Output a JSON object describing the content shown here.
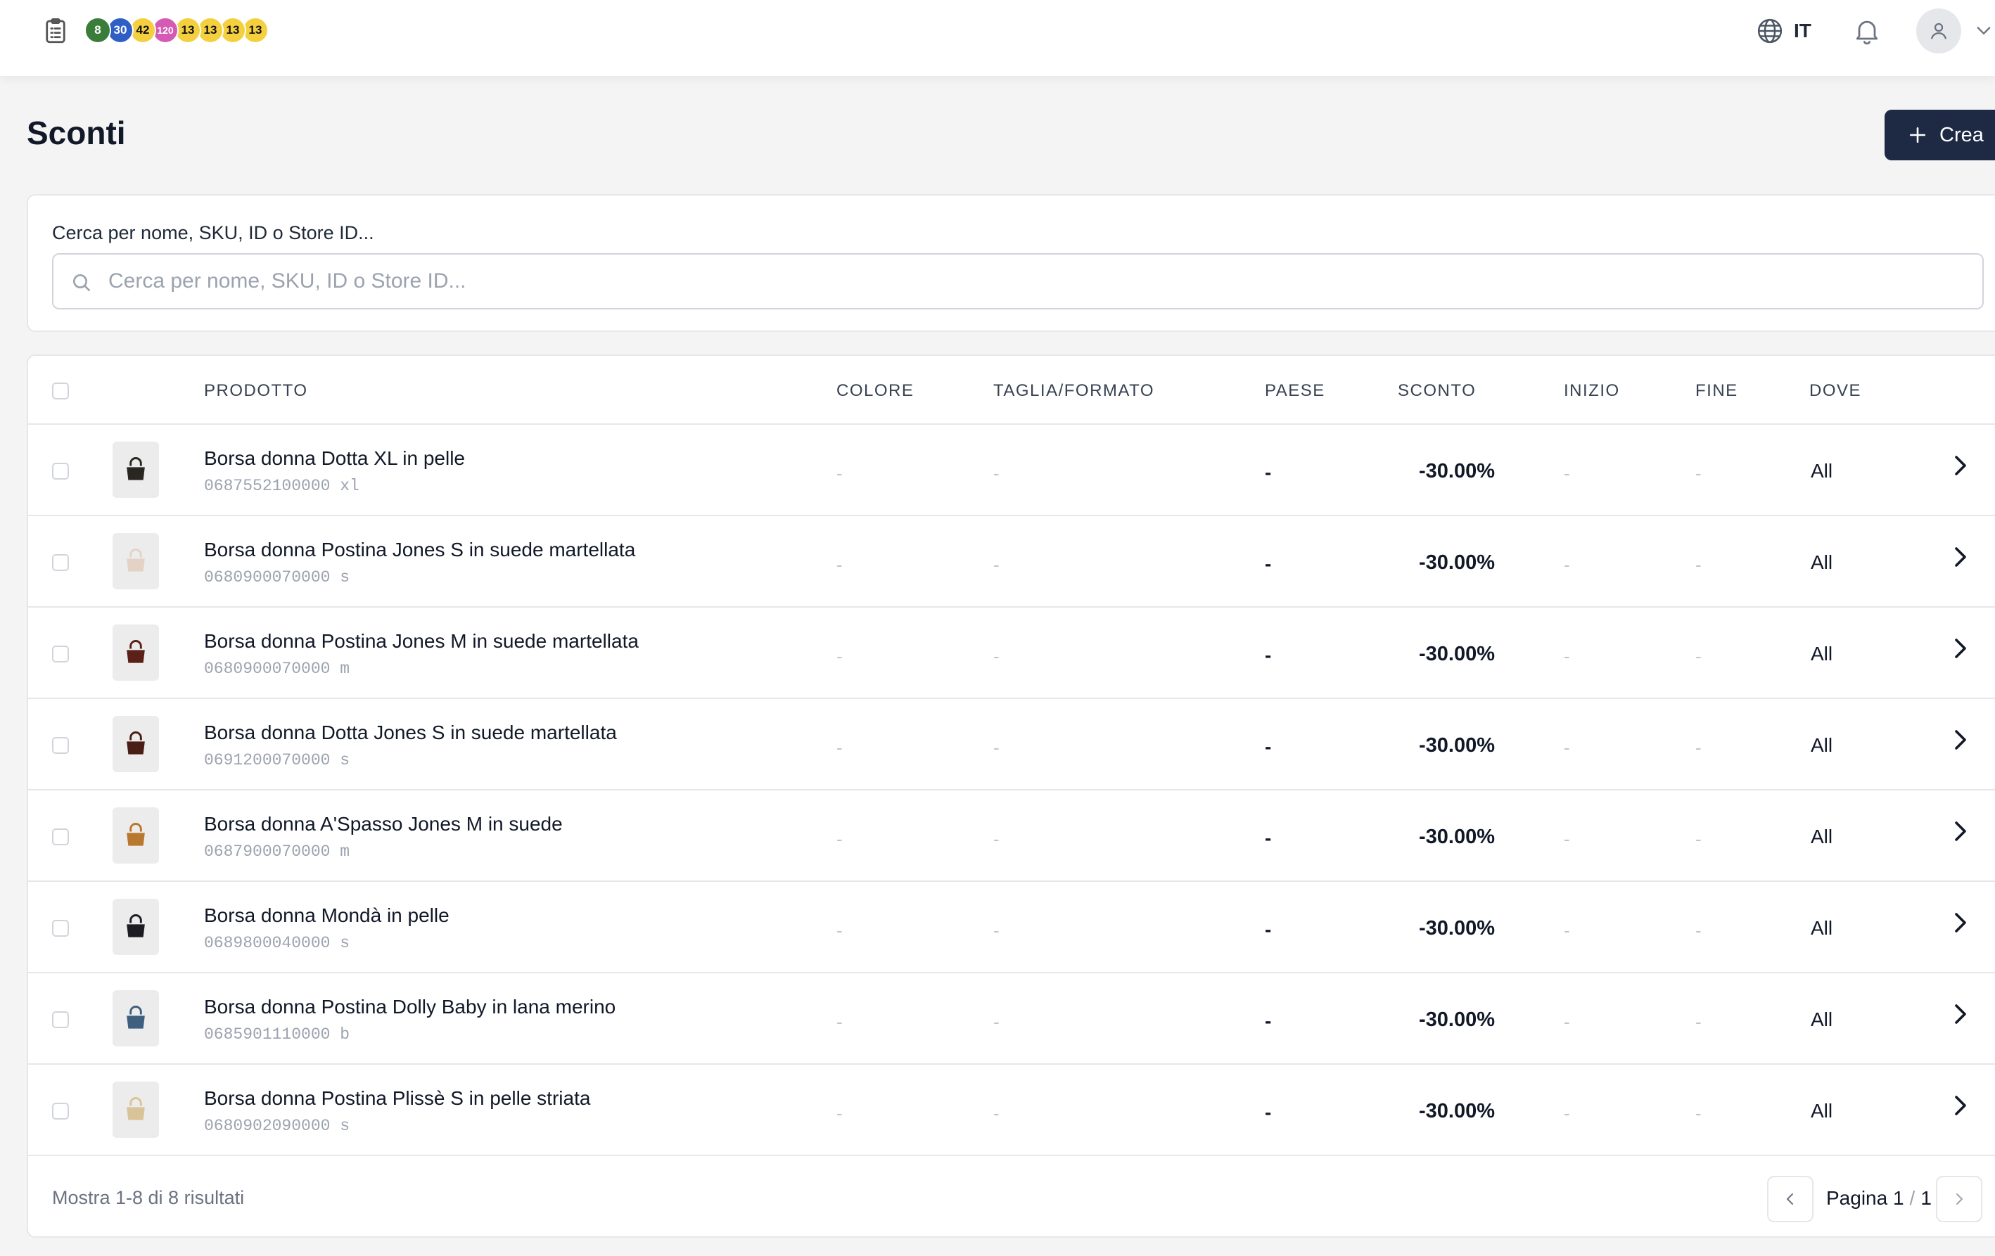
{
  "topbar": {
    "badges": [
      {
        "label": "8",
        "color": "#3a7d3a",
        "text_color": "#ffffff"
      },
      {
        "label": "30",
        "color": "#2f5fc4",
        "text_color": "#ffffff"
      },
      {
        "label": "42",
        "color": "#f4d03f",
        "text_color": "#111111"
      },
      {
        "label": "120",
        "color": "#d45ab4",
        "text_color": "#ffffff"
      },
      {
        "label": "13",
        "color": "#f4d03f",
        "text_color": "#111111"
      },
      {
        "label": "13",
        "color": "#f4d03f",
        "text_color": "#111111"
      },
      {
        "label": "13",
        "color": "#f4d03f",
        "text_color": "#111111"
      },
      {
        "label": "13",
        "color": "#f4d03f",
        "text_color": "#111111"
      }
    ],
    "language": "IT"
  },
  "page": {
    "title": "Sconti",
    "create_label": "Crea"
  },
  "search": {
    "label": "Cerca per nome, SKU, ID o Store ID...",
    "placeholder": "Cerca per nome, SKU, ID o Store ID...",
    "value": ""
  },
  "table": {
    "columns": {
      "product": "PRODOTTO",
      "color": "COLORE",
      "size": "TAGLIA/FORMATO",
      "country": "PAESE",
      "discount": "SCONTO",
      "start": "INIZIO",
      "end": "FINE",
      "where": "DOVE"
    },
    "rows": [
      {
        "name": "Borsa donna Dotta XL in pelle",
        "sku": "0687552100000 xl",
        "color": "-",
        "size": "-",
        "country": "-",
        "discount": "-30.00%",
        "start": "-",
        "end": "-",
        "where": "All",
        "thumb_color": "#2a2622"
      },
      {
        "name": "Borsa donna Postina Jones S in suede martellata",
        "sku": "0680900070000 s",
        "color": "-",
        "size": "-",
        "country": "-",
        "discount": "-30.00%",
        "start": "-",
        "end": "-",
        "where": "All",
        "thumb_color": "#e4d2c6"
      },
      {
        "name": "Borsa donna Postina Jones M in suede martellata",
        "sku": "0680900070000 m",
        "color": "-",
        "size": "-",
        "country": "-",
        "discount": "-30.00%",
        "start": "-",
        "end": "-",
        "where": "All",
        "thumb_color": "#5b2119"
      },
      {
        "name": "Borsa donna Dotta Jones S in suede martellata",
        "sku": "0691200070000 s",
        "color": "-",
        "size": "-",
        "country": "-",
        "discount": "-30.00%",
        "start": "-",
        "end": "-",
        "where": "All",
        "thumb_color": "#4a1e16"
      },
      {
        "name": "Borsa donna A'Spasso Jones M in suede",
        "sku": "0687900070000 m",
        "color": "-",
        "size": "-",
        "country": "-",
        "discount": "-30.00%",
        "start": "-",
        "end": "-",
        "where": "All",
        "thumb_color": "#b8782f"
      },
      {
        "name": "Borsa donna Mondà in pelle",
        "sku": "0689800040000 s",
        "color": "-",
        "size": "-",
        "country": "-",
        "discount": "-30.00%",
        "start": "-",
        "end": "-",
        "where": "All",
        "thumb_color": "#1c1c22"
      },
      {
        "name": "Borsa donna Postina Dolly Baby in lana merino",
        "sku": "0685901110000 b",
        "color": "-",
        "size": "-",
        "country": "-",
        "discount": "-30.00%",
        "start": "-",
        "end": "-",
        "where": "All",
        "thumb_color": "#3f5f7f"
      },
      {
        "name": "Borsa donna Postina Plissè S in pelle striata",
        "sku": "0680902090000 s",
        "color": "-",
        "size": "-",
        "country": "-",
        "discount": "-30.00%",
        "start": "-",
        "end": "-",
        "where": "All",
        "thumb_color": "#d9c49a"
      }
    ]
  },
  "footer": {
    "summary": "Mostra 1-8 di 8 risultati",
    "page_label": "Pagina 1",
    "separator": "/",
    "total_pages": "1"
  }
}
